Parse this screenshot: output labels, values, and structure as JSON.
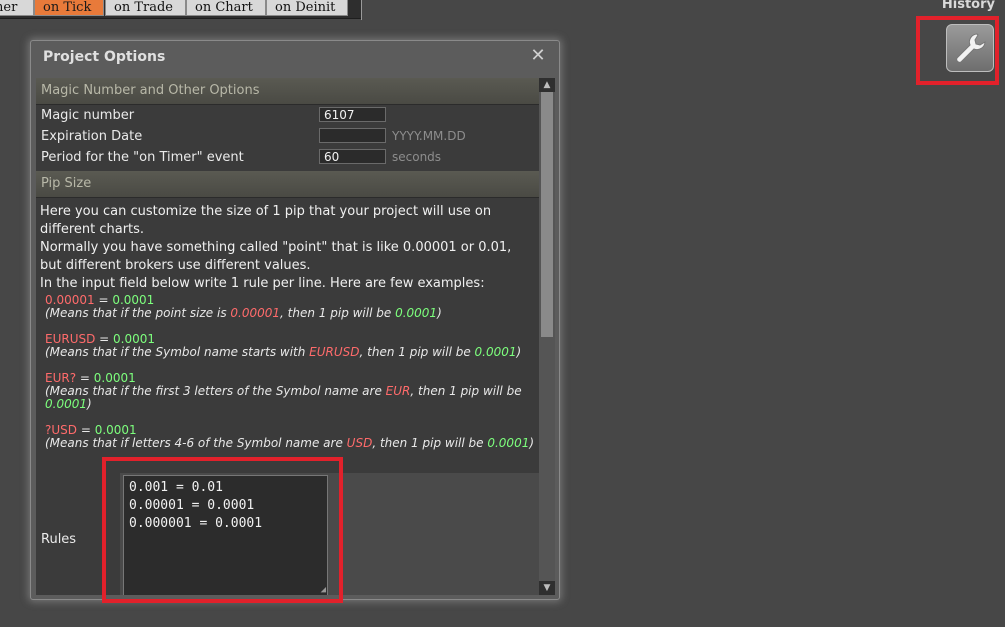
{
  "tabs": [
    {
      "label": "ner",
      "active": false
    },
    {
      "label": "on Tick",
      "active": true
    },
    {
      "label": "on Trade",
      "active": false
    },
    {
      "label": "on Chart",
      "active": false
    },
    {
      "label": "on Deinit",
      "active": false
    }
  ],
  "history_label": "History",
  "toolbar": {
    "tool_icon": "wrench-icon"
  },
  "dialog": {
    "title": "Project Options",
    "close_icon": "close-icon",
    "section1": {
      "title": "Magic Number and Other Options",
      "rows": [
        {
          "label": "Magic number",
          "value": "6107",
          "hint": ""
        },
        {
          "label": "Expiration Date",
          "value": "",
          "hint": "YYYY.MM.DD"
        },
        {
          "label": "Period for the \"on Timer\" event",
          "value": "60",
          "hint": "seconds"
        }
      ]
    },
    "section2": {
      "title": "Pip Size",
      "info_lines": [
        "Here you can customize the size of 1 pip that your project will use on different charts.",
        "Normally you have something called \"point\" that is like 0.00001 or 0.01, but different brokers use different values.",
        "In the input field below write 1 rule per line. Here are few examples:"
      ],
      "examples": [
        {
          "key": "0.00001",
          "val": "0.0001",
          "desc_pre": "(Means that if the point size is ",
          "desc_key": "0.00001",
          "desc_mid": ", then 1 pip will be ",
          "desc_val": "0.0001",
          "desc_post": ")"
        },
        {
          "key": "EURUSD",
          "val": "0.0001",
          "desc_pre": "(Means that if the Symbol name starts with ",
          "desc_key": "EURUSD",
          "desc_mid": ", then 1 pip will be ",
          "desc_val": "0.0001",
          "desc_post": ")"
        },
        {
          "key": "EUR?",
          "val": "0.0001",
          "desc_pre": "(Means that if the first 3 letters of the Symbol name are ",
          "desc_key": "EUR",
          "desc_mid": ", then 1 pip will be ",
          "desc_val": "0.0001",
          "desc_post": ")"
        },
        {
          "key": "?USD",
          "val": "0.0001",
          "desc_pre": "(Means that if letters 4-6 of the Symbol name are ",
          "desc_key": "USD",
          "desc_mid": ", then 1 pip will be ",
          "desc_val": "0.0001",
          "desc_post": ")"
        }
      ],
      "rules_label": "Rules",
      "rules_lines": [
        "0.001 = 0.01",
        "0.00001 = 0.0001",
        "0.000001 = 0.0001"
      ]
    }
  },
  "colors": {
    "accent_tab": "#e87a3a",
    "highlight": "#e2212b",
    "key_red": "#ff6b6b",
    "val_green": "#7dff7d"
  }
}
